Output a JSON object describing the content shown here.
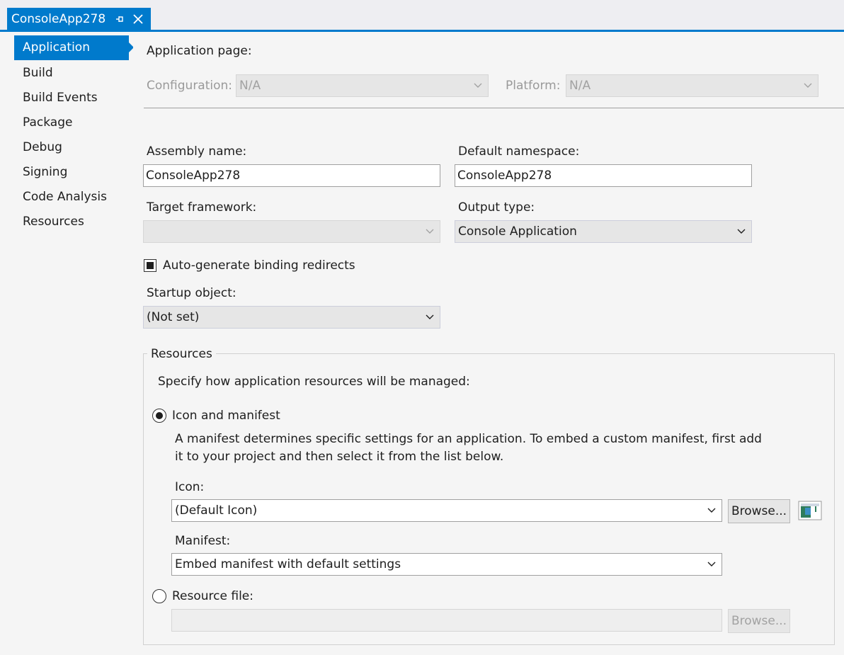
{
  "tab": {
    "title": "ConsoleApp278"
  },
  "sidebar": {
    "items": [
      {
        "label": "Application",
        "active": true
      },
      {
        "label": "Build"
      },
      {
        "label": "Build Events"
      },
      {
        "label": "Package"
      },
      {
        "label": "Debug"
      },
      {
        "label": "Signing"
      },
      {
        "label": "Code Analysis"
      },
      {
        "label": "Resources"
      }
    ]
  },
  "page": {
    "heading": "Application page:",
    "configuration_label": "Configuration:",
    "configuration_value": "N/A",
    "platform_label": "Platform:",
    "platform_value": "N/A",
    "assembly_name_label": "Assembly name:",
    "assembly_name_value": "ConsoleApp278",
    "default_namespace_label": "Default namespace:",
    "default_namespace_value": "ConsoleApp278",
    "target_framework_label": "Target framework:",
    "target_framework_value": "",
    "output_type_label": "Output type:",
    "output_type_value": "Console Application",
    "auto_binding_label": "Auto-generate binding redirects",
    "startup_object_label": "Startup object:",
    "startup_object_value": "(Not set)"
  },
  "resources": {
    "group_title": "Resources",
    "description": "Specify how application resources will be managed:",
    "icon_manifest_label": "Icon and manifest",
    "manifest_help_line1": "A manifest determines specific settings for an application. To embed a custom manifest, first add",
    "manifest_help_line2": "it to your project and then select it from the list below.",
    "icon_label": "Icon:",
    "icon_value": "(Default Icon)",
    "browse_label": "Browse...",
    "manifest_label": "Manifest:",
    "manifest_value": "Embed manifest with default settings",
    "resource_file_label": "Resource file:",
    "resource_file_value": "",
    "browse_disabled_label": "Browse..."
  },
  "colors": {
    "accent": "#007acc",
    "background": "#f5f5f5"
  }
}
